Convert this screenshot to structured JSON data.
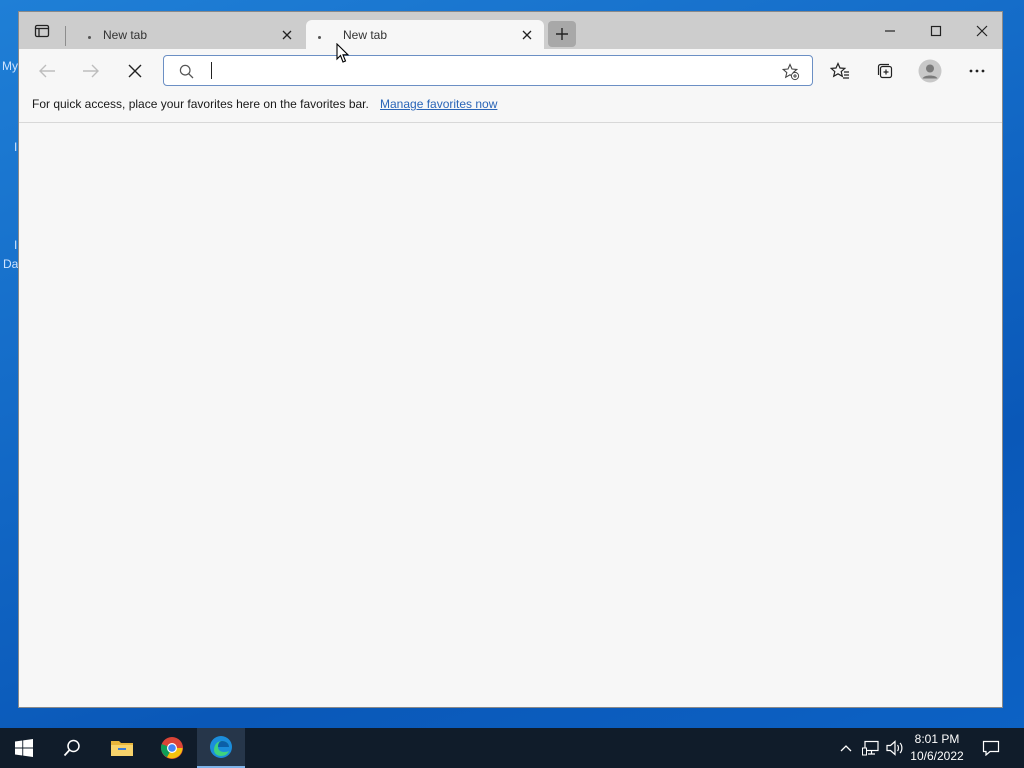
{
  "desktop": {
    "fragments": [
      "My",
      "I",
      "I",
      "Da"
    ]
  },
  "browser": {
    "tabs": [
      {
        "label": "New tab",
        "active": false
      },
      {
        "label": "New tab",
        "active": true
      }
    ],
    "address_bar": {
      "value": "",
      "placeholder": ""
    },
    "favorites_bar": {
      "message": "For quick access, place your favorites here on the favorites bar.",
      "link": "Manage favorites now"
    }
  },
  "taskbar": {
    "apps": [
      "start",
      "search",
      "file-explorer",
      "chrome",
      "edge"
    ],
    "clock": {
      "time": "8:01 PM",
      "date": "10/6/2022"
    }
  },
  "colors": {
    "accent": "#2a65b8",
    "taskbar": "#101c2a",
    "desktop": "#1166c4"
  }
}
